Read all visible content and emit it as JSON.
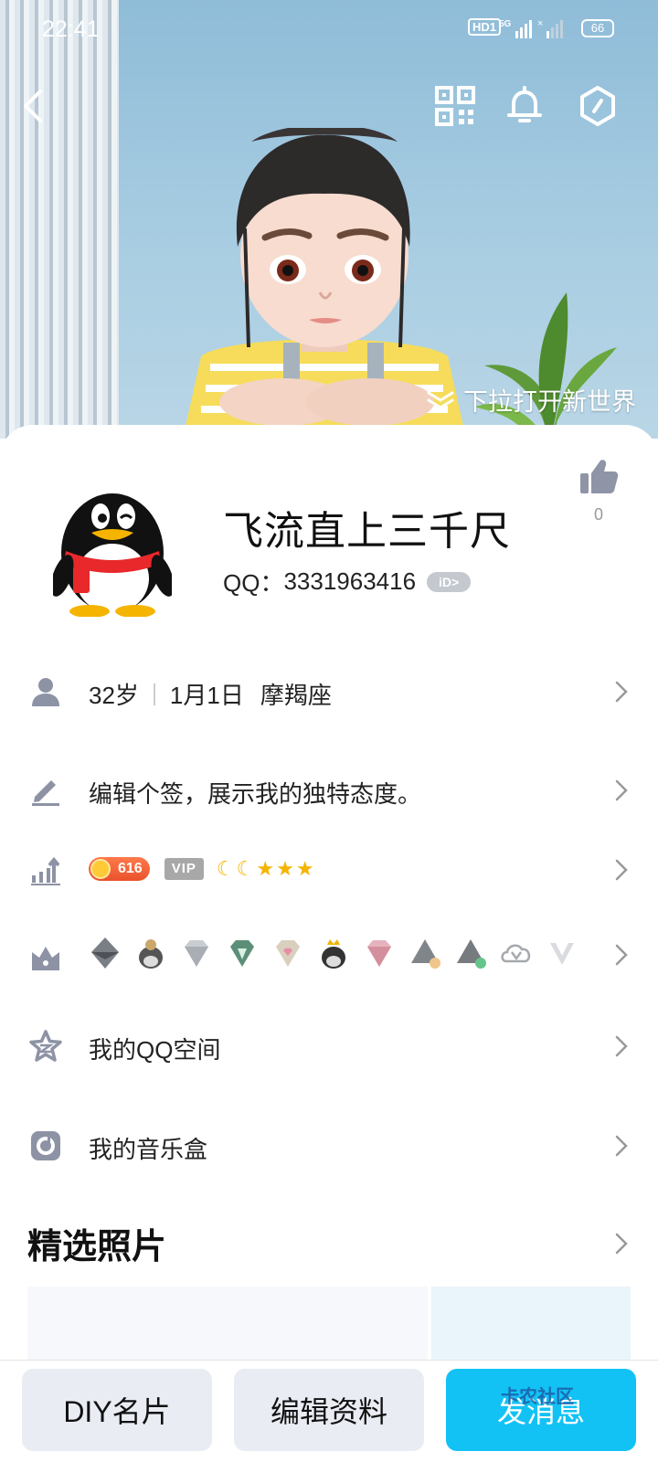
{
  "status_bar": {
    "time": "22:41",
    "network_badge": "HD1",
    "network_type": "5G",
    "battery": "66"
  },
  "header": {
    "back_icon": "chevron-left-icon",
    "qr_icon": "qr-code-icon",
    "bell_icon": "bell-icon",
    "settings_icon": "hexagon-settings-icon",
    "pull_hint": "下拉打开新世界"
  },
  "profile": {
    "nickname": "飞流直上三千尺",
    "qq_label": "QQ：",
    "qq_number": "3331963416",
    "id_badge": "iD>",
    "like_count": "0"
  },
  "info_rows": {
    "basic": {
      "age": "32岁",
      "birthday": "1月1日",
      "zodiac": "摩羯座"
    },
    "signature": "编辑个签，展示我的独特态度。",
    "level": {
      "coin_value": "616",
      "vip_label": "VIP",
      "moons": 2,
      "stars": 3
    },
    "qzone": "我的QQ空间",
    "music": "我的音乐盒"
  },
  "photos": {
    "title": "精选照片"
  },
  "bottom_bar": {
    "diy_card": "DIY名片",
    "edit_profile": "编辑资料",
    "send_message": "发消息"
  },
  "watermark": "卡农社区",
  "colors": {
    "accent": "#12c2f5",
    "button_gray": "#e9ecf3",
    "coin": "#e9522c"
  }
}
